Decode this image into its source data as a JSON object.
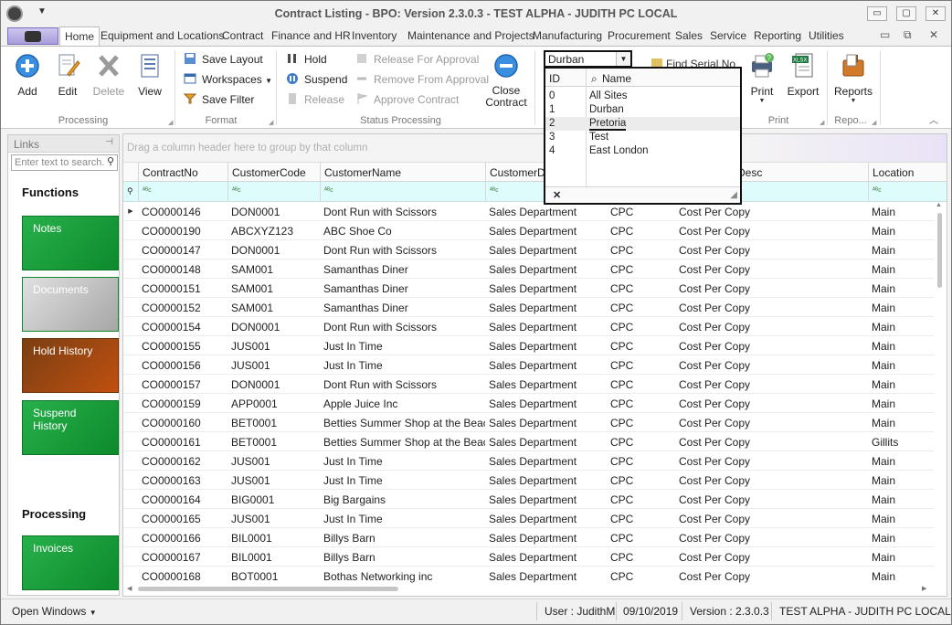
{
  "window": {
    "title": "Contract Listing - BPO: Version 2.3.0.3 - TEST ALPHA - JUDITH PC LOCAL",
    "min": "▭",
    "max": "▢",
    "close": "✕"
  },
  "menu": {
    "tabs": [
      "Home",
      "Equipment and Locations",
      "Contract",
      "Finance and HR",
      "Inventory",
      "Maintenance and Projects",
      "Manufacturing",
      "Procurement",
      "Sales",
      "Service",
      "Reporting",
      "Utilities"
    ],
    "active_tab": "Home",
    "mdi_min": "▭",
    "mdi_restore": "⧉",
    "mdi_close": "✕"
  },
  "ribbon": {
    "processing": {
      "label": "Processing",
      "add": "Add",
      "edit": "Edit",
      "delete": "Delete",
      "view": "View"
    },
    "format": {
      "label": "Format",
      "save_layout": "Save Layout",
      "workspaces": "Workspaces",
      "save_filter": "Save Filter"
    },
    "status_processing": {
      "label": "Status Processing",
      "hold": "Hold",
      "suspend": "Suspend",
      "release": "Release",
      "release_for_approval": "Release For Approval",
      "remove_from_approval": "Remove From Approval",
      "approve_contract": "Approve Contract",
      "close_contract": "Close Contract"
    },
    "site": {
      "selected": "Durban",
      "find_serial": "Find Serial No"
    },
    "print": {
      "label": "Print",
      "print": "Print",
      "export": "Export"
    },
    "reports": {
      "label": "Repo...",
      "reports": "Reports"
    }
  },
  "site_popup": {
    "col_id": "ID",
    "col_name": "Name",
    "rows": [
      {
        "id": "0",
        "name": "All Sites"
      },
      {
        "id": "1",
        "name": "Durban"
      },
      {
        "id": "2",
        "name": "Pretoria"
      },
      {
        "id": "3",
        "name": "Test"
      },
      {
        "id": "4",
        "name": "East London"
      }
    ],
    "highlighted_index": 2,
    "close": "✕"
  },
  "links_panel": {
    "title": "Links",
    "pin": "⊣",
    "search_placeholder": "Enter text to search...",
    "functions_heading": "Functions",
    "processing_heading": "Processing",
    "tiles": {
      "notes": "Notes",
      "documents": "Documents",
      "hold_history": "Hold History",
      "suspend_history": "Suspend History",
      "invoices": "Invoices"
    }
  },
  "grid": {
    "group_hint": "Drag a column header here to group by that column",
    "columns": [
      "ContractNo",
      "CustomerCode",
      "CustomerName",
      "CustomerDe",
      "",
      "Desc",
      "Location"
    ],
    "filter_glyph": "ᴬᴮc",
    "rows": [
      [
        "CO0000146",
        "DON0001",
        "Dont Run with Scissors",
        "Sales Department",
        "CPC",
        "Cost Per Copy",
        "Main"
      ],
      [
        "CO0000190",
        "ABCXYZ123",
        "ABC Shoe Co",
        "Sales Department",
        "CPC",
        "Cost Per Copy",
        "Main"
      ],
      [
        "CO0000147",
        "DON0001",
        "Dont Run with Scissors",
        "Sales Department",
        "CPC",
        "Cost Per Copy",
        "Main"
      ],
      [
        "CO0000148",
        "SAM001",
        "Samanthas Diner",
        "Sales Department",
        "CPC",
        "Cost Per Copy",
        "Main"
      ],
      [
        "CO0000151",
        "SAM001",
        "Samanthas Diner",
        "Sales Department",
        "CPC",
        "Cost Per Copy",
        "Main"
      ],
      [
        "CO0000152",
        "SAM001",
        "Samanthas Diner",
        "Sales Department",
        "CPC",
        "Cost Per Copy",
        "Main"
      ],
      [
        "CO0000154",
        "DON0001",
        "Dont Run with Scissors",
        "Sales Department",
        "CPC",
        "Cost Per Copy",
        "Main"
      ],
      [
        "CO0000155",
        "JUS001",
        "Just In Time",
        "Sales Department",
        "CPC",
        "Cost Per Copy",
        "Main"
      ],
      [
        "CO0000156",
        "JUS001",
        "Just In Time",
        "Sales Department",
        "CPC",
        "Cost Per Copy",
        "Main"
      ],
      [
        "CO0000157",
        "DON0001",
        "Dont Run with Scissors",
        "Sales Department",
        "CPC",
        "Cost Per Copy",
        "Main"
      ],
      [
        "CO0000159",
        "APP0001",
        "Apple Juice Inc",
        "Sales Department",
        "CPC",
        "Cost Per Copy",
        "Main"
      ],
      [
        "CO0000160",
        "BET0001",
        "Betties Summer Shop at the Beach",
        "Sales Department",
        "CPC",
        "Cost Per Copy",
        "Main"
      ],
      [
        "CO0000161",
        "BET0001",
        "Betties Summer Shop at the Beach",
        "Sales Department",
        "CPC",
        "Cost Per Copy",
        "Gillits"
      ],
      [
        "CO0000162",
        "JUS001",
        "Just In Time",
        "Sales Department",
        "CPC",
        "Cost Per Copy",
        "Main"
      ],
      [
        "CO0000163",
        "JUS001",
        "Just In Time",
        "Sales Department",
        "CPC",
        "Cost Per Copy",
        "Main"
      ],
      [
        "CO0000164",
        "BIG0001",
        "Big Bargains",
        "Sales Department",
        "CPC",
        "Cost Per Copy",
        "Main"
      ],
      [
        "CO0000165",
        "JUS001",
        "Just In Time",
        "Sales Department",
        "CPC",
        "Cost Per Copy",
        "Main"
      ],
      [
        "CO0000166",
        "BIL0001",
        "Billys Barn",
        "Sales Department",
        "CPC",
        "Cost Per Copy",
        "Main"
      ],
      [
        "CO0000167",
        "BIL0001",
        "Billys Barn",
        "Sales Department",
        "CPC",
        "Cost Per Copy",
        "Main"
      ],
      [
        "CO0000168",
        "BOT0001",
        "Bothas Networking inc",
        "Sales Department",
        "CPC",
        "Cost Per Copy",
        "Main"
      ]
    ]
  },
  "statusbar": {
    "open_windows": "Open Windows",
    "user": "User : JudithM",
    "date": "09/10/2019",
    "version": "Version : 2.3.0.3",
    "env": "TEST ALPHA - JUDITH PC LOCAL"
  },
  "colors": {
    "tile_green": "#0d8a2d",
    "tile_brown": "#c05010",
    "filter_row": "#dffcfc",
    "app_button": "#a89cd8"
  }
}
